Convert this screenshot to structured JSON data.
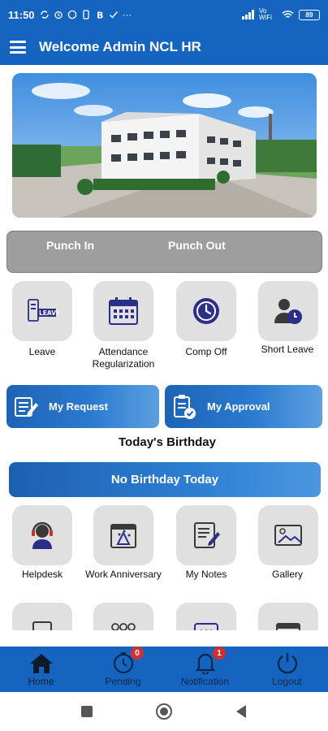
{
  "status_bar": {
    "time": "11:50",
    "left_icons": [
      "sync-icon",
      "alarm-icon",
      "whatsapp-icon",
      "phone-icon",
      "bitcoin-icon",
      "check-icon"
    ],
    "more": "···",
    "network": "Vo WiFi",
    "battery": "89"
  },
  "app_bar": {
    "title": "Welcome Admin NCL HR"
  },
  "banner": {
    "icon": "factory-building-photo"
  },
  "punch": {
    "punch_in": "Punch In",
    "punch_out": "Punch Out"
  },
  "menu_row1": [
    {
      "label": "Leave",
      "icon": "leave-icon"
    },
    {
      "label": "Attendance Regularization",
      "icon": "calendar-icon"
    },
    {
      "label": "Comp Off",
      "icon": "clock-icon"
    },
    {
      "label": "Short Leave",
      "icon": "person-clock-icon"
    }
  ],
  "actions": {
    "my_request": "My Request",
    "my_approval": "My Approval"
  },
  "birthday": {
    "heading": "Today's Birthday",
    "message": "No Birthday Today"
  },
  "menu_row2": [
    {
      "label": "Helpdesk",
      "icon": "headset-icon"
    },
    {
      "label": "Work Anniversary",
      "icon": "anniversary-icon"
    },
    {
      "label": "My Notes",
      "icon": "notes-icon"
    },
    {
      "label": "Gallery",
      "icon": "gallery-icon"
    }
  ],
  "bottom_nav": {
    "items": [
      {
        "label": "Home",
        "icon": "home-icon"
      },
      {
        "label": "Pending",
        "icon": "timer-icon",
        "badge": "0"
      },
      {
        "label": "Notification",
        "icon": "bell-icon",
        "badge": "1"
      },
      {
        "label": "Logout",
        "icon": "power-icon"
      }
    ]
  },
  "colors": {
    "primary": "#1565c0",
    "tile_bg": "#e0e0e0",
    "punch_bg": "#9e9e9e",
    "badge": "#d32f2f",
    "icon_navy": "#2b2f8a"
  }
}
